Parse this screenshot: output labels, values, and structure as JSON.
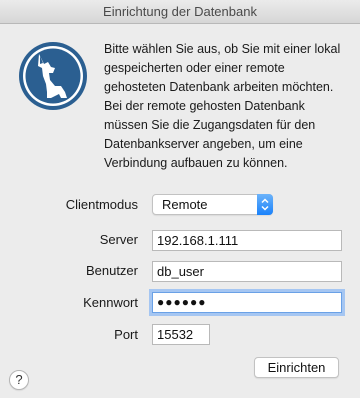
{
  "window": {
    "title": "Einrichtung der Datenbank"
  },
  "icons": {
    "logo": "dog-logo-icon",
    "select": "chevron-updown-icon",
    "help": "help-icon"
  },
  "description": "Bitte wählen Sie aus, ob Sie mit einer lokal gespeicherten oder einer remote gehosteten Datenbank arbeiten möchten. Bei der remote gehosten Datenbank müssen Sie die Zugangsdaten für den Datenbankserver angeben, um eine Verbindung aufbauen zu können.",
  "form": {
    "clientmode": {
      "label": "Clientmodus",
      "value": "Remote"
    },
    "server": {
      "label": "Server",
      "value": "192.168.1.111"
    },
    "user": {
      "label": "Benutzer",
      "value": "db_user"
    },
    "password": {
      "label": "Kennwort",
      "value": "●●●●●●"
    },
    "port": {
      "label": "Port",
      "value": "15532"
    }
  },
  "buttons": {
    "setup": "Einrichten",
    "help": "?"
  },
  "colors": {
    "accent": "#1a82fb",
    "logo": "#2b5f91"
  }
}
